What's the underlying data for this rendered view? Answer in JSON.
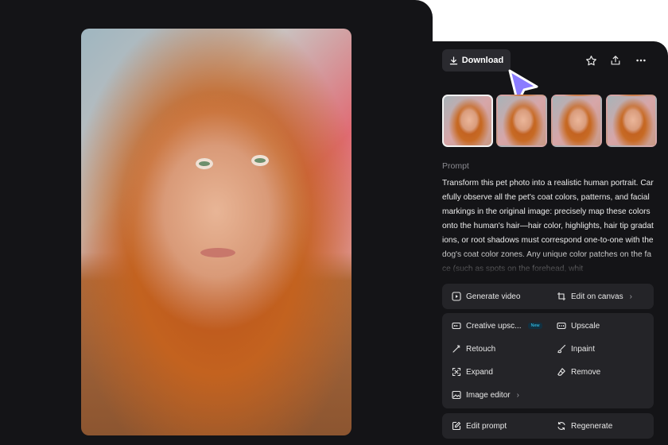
{
  "toolbar": {
    "download_label": "Download",
    "icons": [
      "download-icon",
      "star-icon",
      "share-icon",
      "more-icon"
    ]
  },
  "thumbnails": [
    {
      "name": "thumbnail-1",
      "selected": true
    },
    {
      "name": "thumbnail-2",
      "selected": false
    },
    {
      "name": "thumbnail-3",
      "selected": false
    },
    {
      "name": "thumbnail-4",
      "selected": false
    }
  ],
  "prompt": {
    "label": "Prompt",
    "text": "Transform this pet photo into a realistic human portrait. Carefully observe all the pet's coat colors, patterns, and facial markings in the original image: precisely map these colors onto the human's hair—hair color, highlights, hair tip gradations, or root shadows must correspond one-to-one with the dog's coat color zones. Any unique color patches on the face (such as spots on the forehead, whit"
  },
  "actions": {
    "generate_video": "Generate video",
    "edit_on_canvas": "Edit on canvas",
    "creative_upscale": "Creative upsc...",
    "new_badge": "New",
    "upscale": "Upscale",
    "retouch": "Retouch",
    "inpaint": "Inpaint",
    "expand": "Expand",
    "remove": "Remove",
    "image_editor": "Image editor",
    "edit_prompt": "Edit prompt",
    "regenerate": "Regenerate"
  },
  "colors": {
    "panel_bg": "#141417",
    "card_bg": "#242428",
    "cursor": "#8b7cff",
    "new_badge": "#39d5ff"
  }
}
